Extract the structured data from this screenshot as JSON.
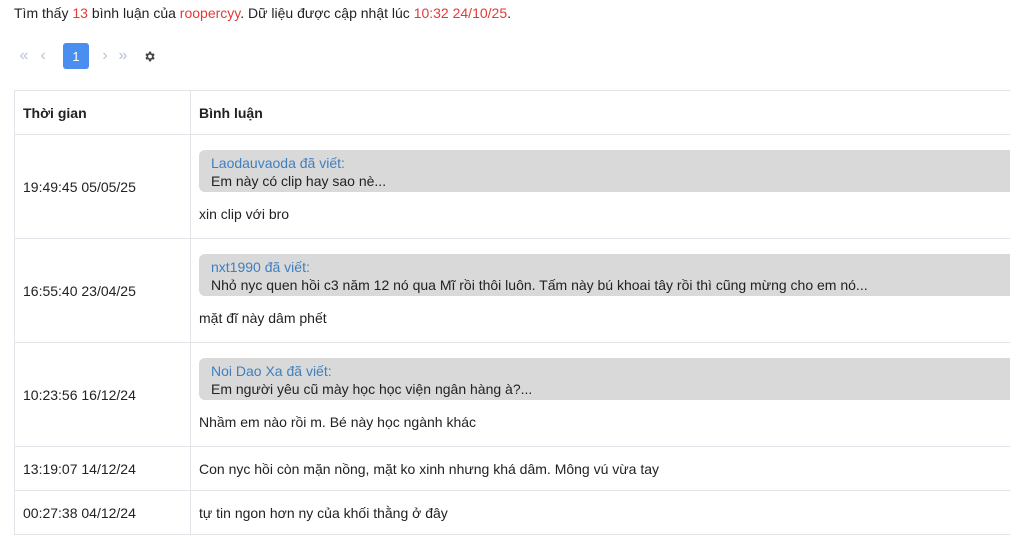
{
  "summary": {
    "prefix": "Tìm thấy ",
    "count": "13",
    "mid": " bình luận của ",
    "user": "roopercyy",
    "mid2": ". Dữ liệu được cập nhật lúc ",
    "updated": "10:32 24/10/25",
    "suffix": "."
  },
  "pagination": {
    "first": "«",
    "prev": "‹",
    "current": "1",
    "next": "›",
    "last": "»",
    "settings_icon": "gear-icon"
  },
  "table": {
    "headers": {
      "time": "Thời gian",
      "comment": "Bình luận"
    },
    "rows": [
      {
        "time": "19:49:45 05/05/25",
        "quote_author": "Laodauvaoda đã viết:",
        "quote_text": "Em này có clip hay sao nè...",
        "comment": "xin clip với bro"
      },
      {
        "time": "16:55:40 23/04/25",
        "quote_author": "nxt1990 đã viết:",
        "quote_text": "Nhỏ nyc quen hồi c3 năm 12 nó qua Mĩ rồi thôi luôn. Tấm này bú khoai tây rồi thì cũng mừng cho em nó...",
        "comment": "mặt đĩ này dâm phết"
      },
      {
        "time": "10:23:56 16/12/24",
        "quote_author": "Noi Dao Xa đã viết:",
        "quote_text": "Em người yêu cũ mày học học viện ngân hàng à?...",
        "comment": "Nhầm em nào rồi m. Bé này học ngành khác"
      },
      {
        "time": "13:19:07 14/12/24",
        "comment": "Con nyc hồi còn mặn nồng, mặt ko xinh nhưng khá dâm. Mông vú vừa tay"
      },
      {
        "time": "00:27:38 04/12/24",
        "comment": "tự tin ngon hơn ny của khối thằng ở đây"
      }
    ]
  }
}
